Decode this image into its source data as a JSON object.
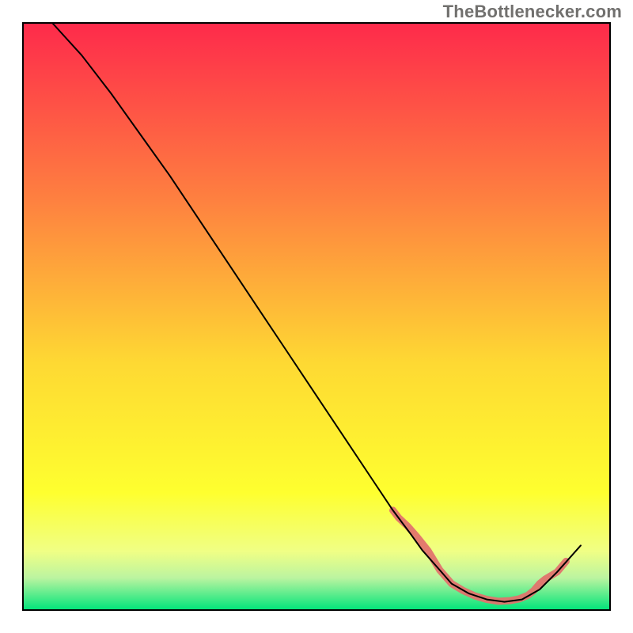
{
  "attribution": "TheBottlenecker.com",
  "chart_data": {
    "type": "line",
    "title": "",
    "xlabel": "",
    "ylabel": "",
    "xlim": [
      0,
      100
    ],
    "ylim": [
      0,
      100
    ],
    "background_gradient": {
      "top": "#fe2a4b",
      "upper_mid": "#fe8040",
      "mid": "#fed933",
      "lower_mid": "#feff2f",
      "band": "#f0ff85",
      "bottom_band_top": "#bcf4a0",
      "bottom_band_bottom": "#00e47a"
    },
    "series": [
      {
        "name": "main-curve",
        "color": "#000000",
        "stroke_width": 2,
        "x": [
          5,
          10,
          15,
          20,
          25,
          30,
          35,
          40,
          45,
          50,
          55,
          60,
          63,
          66,
          68,
          71,
          73,
          76,
          79,
          82,
          85,
          88,
          91,
          95
        ],
        "y": [
          100,
          94.5,
          88,
          81,
          74,
          66.5,
          59,
          51.5,
          44,
          36.5,
          29,
          21.5,
          17,
          13,
          10.2,
          6.8,
          4.5,
          2.8,
          1.8,
          1.4,
          1.8,
          3.5,
          6.5,
          11
        ]
      },
      {
        "name": "highlight-band",
        "color": "#e2736d",
        "stroke_width": 9,
        "opacity": 0.95,
        "x": [
          63,
          64,
          65.5,
          67,
          69,
          71,
          73,
          75,
          77,
          79,
          81,
          83,
          84.5,
          86,
          87,
          88,
          89,
          91,
          92.5
        ],
        "y": [
          17,
          15.7,
          14.3,
          12.6,
          10.1,
          6.8,
          4.5,
          3.3,
          2.4,
          1.8,
          1.5,
          1.6,
          1.9,
          2.5,
          3.3,
          4.5,
          5.3,
          6.5,
          8.3
        ]
      }
    ]
  }
}
